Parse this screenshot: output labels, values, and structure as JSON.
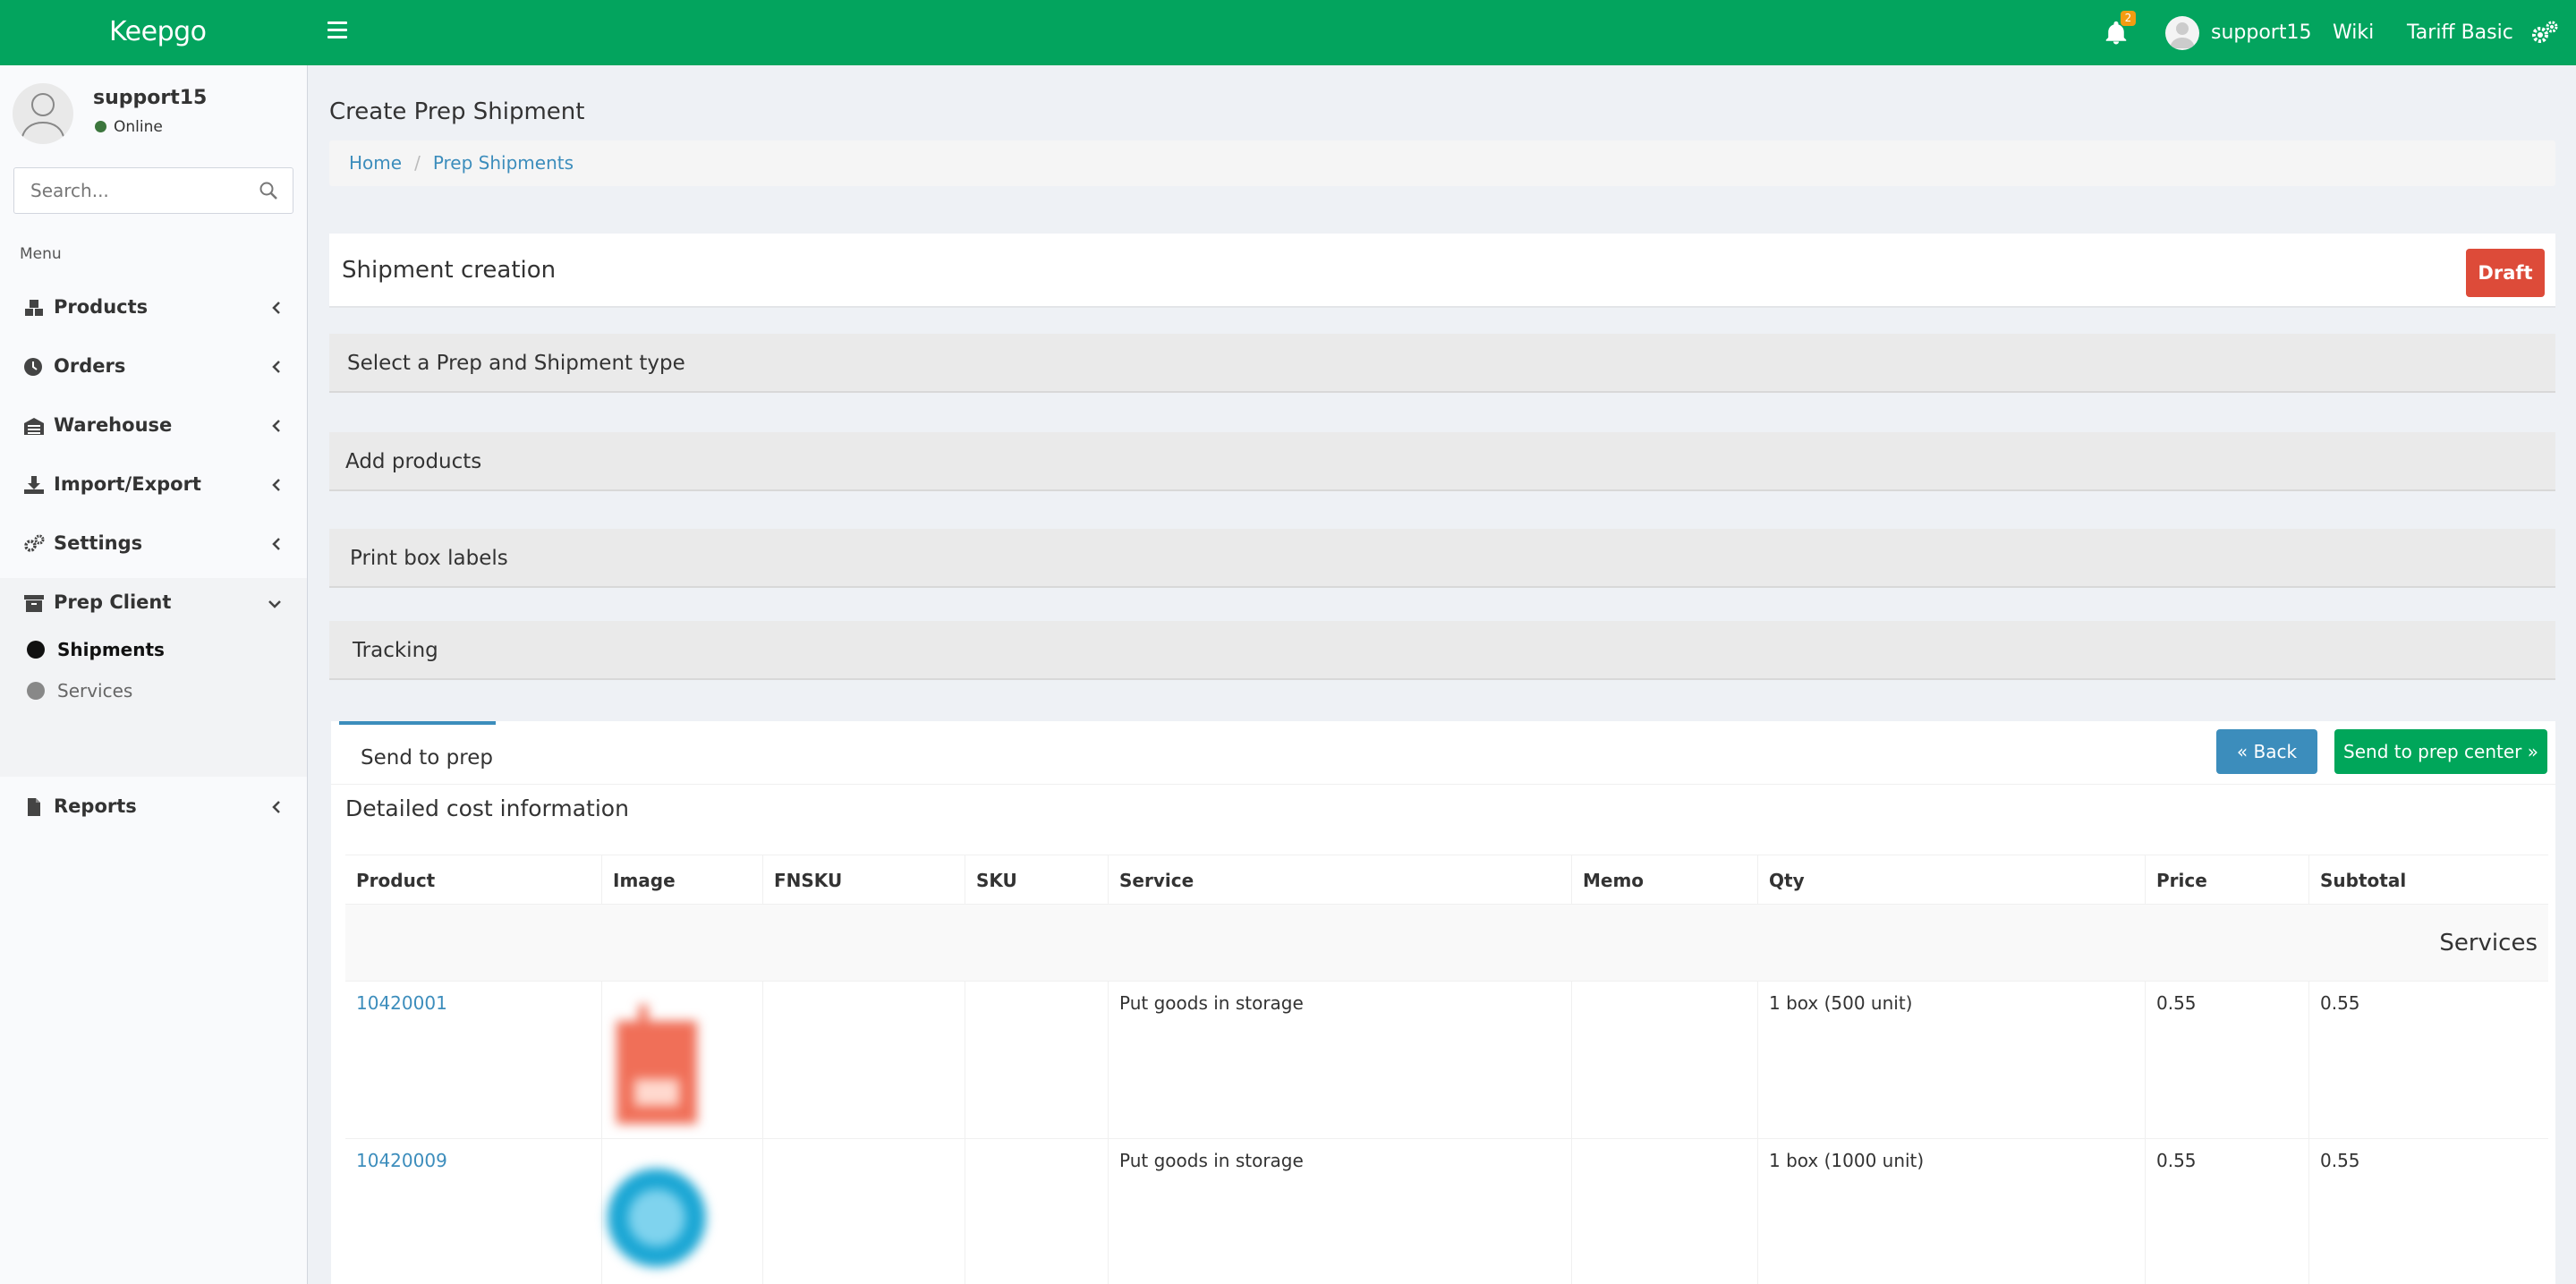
{
  "app": {
    "logo": "Keepgo",
    "notifications_count": "2",
    "username": "support15",
    "wiki": "Wiki",
    "tariff": "Tariff Basic"
  },
  "sidebar": {
    "username": "support15",
    "status": "Online",
    "search_placeholder": "Search...",
    "menu_label": "Menu",
    "items": [
      {
        "label": "Products",
        "icon": "cubes-icon"
      },
      {
        "label": "Orders",
        "icon": "clock-icon"
      },
      {
        "label": "Warehouse",
        "icon": "warehouse-icon"
      },
      {
        "label": "Import/Export",
        "icon": "download-icon"
      },
      {
        "label": "Settings",
        "icon": "gears-icon"
      },
      {
        "label": "Prep Client",
        "icon": "archive-icon"
      },
      {
        "label": "Reports",
        "icon": "file-icon"
      }
    ],
    "sub_items": [
      {
        "label": "Shipments"
      },
      {
        "label": "Services"
      }
    ]
  },
  "page": {
    "title": "Create Prep Shipment",
    "breadcrumb": [
      "Home",
      "Prep Shipments"
    ]
  },
  "shipment": {
    "header": "Shipment creation",
    "status": "Draft",
    "steps": [
      "Select a Prep and Shipment type",
      "Add products",
      "Print box labels",
      "Tracking"
    ],
    "tab": "Send to prep",
    "back_button": "Back",
    "send_button": "Send to prep center",
    "detail_title": "Detailed cost information"
  },
  "table": {
    "columns": [
      "Product",
      "Image",
      "FNSKU",
      "SKU",
      "Service",
      "Memo",
      "Qty",
      "Price",
      "Subtotal"
    ],
    "group_label": "Services",
    "rows": [
      {
        "product": "10420001",
        "fnsku": "",
        "sku": "",
        "service": "Put goods in storage",
        "memo": "",
        "qty": "1 box (500 unit)",
        "price": "0.55",
        "subtotal": "0.55"
      },
      {
        "product": "10420009",
        "fnsku": "",
        "sku": "",
        "service": "Put goods in storage",
        "memo": "",
        "qty": "1 box (1000 unit)",
        "price": "0.55",
        "subtotal": "0.55"
      }
    ]
  },
  "colors": {
    "topbar": "#03a45e",
    "draft": "#dd4b39",
    "back": "#3c8dbc",
    "send": "#00a65a",
    "link": "#3c8dbc"
  }
}
